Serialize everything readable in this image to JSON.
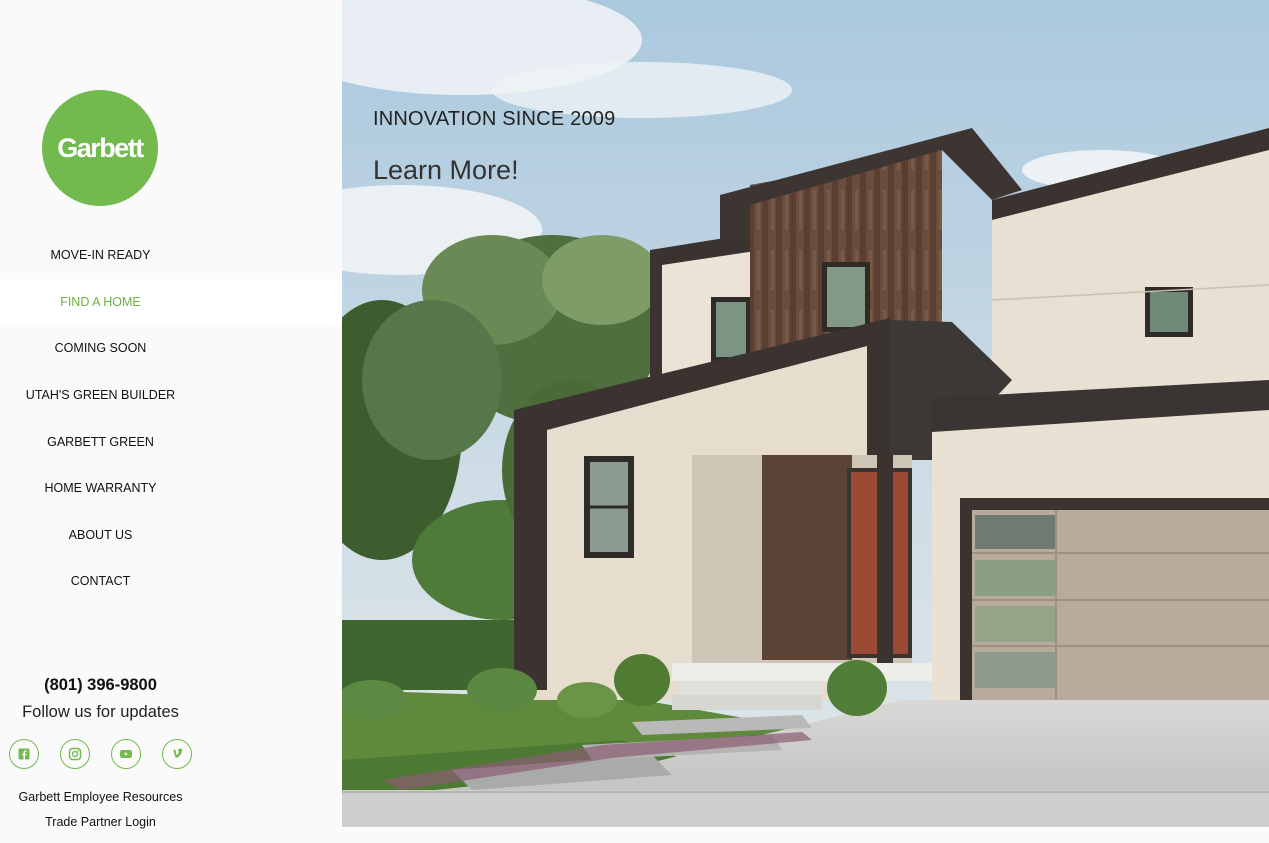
{
  "logo": {
    "text": "Garbett"
  },
  "nav": [
    {
      "label": "MOVE-IN READY"
    },
    {
      "label": "FIND A HOME"
    },
    {
      "label": "COMING SOON"
    },
    {
      "label": "UTAH'S GREEN BUILDER"
    },
    {
      "label": "GARBETT GREEN"
    },
    {
      "label": "HOME WARRANTY"
    },
    {
      "label": "ABOUT US"
    },
    {
      "label": "CONTACT"
    }
  ],
  "active_nav": "FIND A HOME",
  "contact": {
    "phone": "(801) 396-9800",
    "follow_text": "Follow us for updates"
  },
  "social": [
    {
      "icon": "facebook-icon"
    },
    {
      "icon": "instagram-icon"
    },
    {
      "icon": "youtube-icon"
    },
    {
      "icon": "vimeo-icon"
    }
  ],
  "footer_links": {
    "employee": "Garbett Employee Resources",
    "trade": "Trade Partner Login"
  },
  "hero": {
    "tagline": "INNOVATION SINCE 2009",
    "cta": "Learn More!"
  },
  "colors": {
    "brand_green": "#72b94e",
    "active_nav_text": "#6db344",
    "sidebar_bg": "#fafafa"
  }
}
